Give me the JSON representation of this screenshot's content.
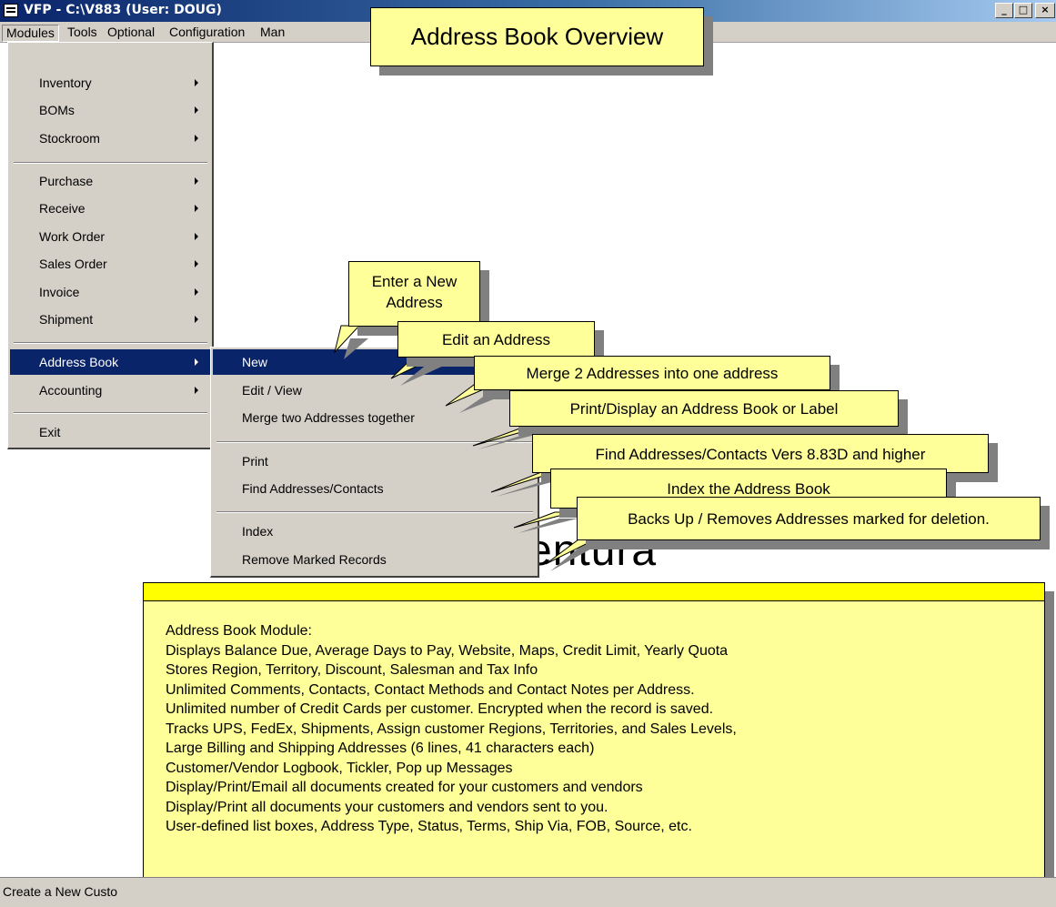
{
  "titlebar": {
    "title": "VFP - C:\\V883  (User: DOUG)",
    "minimize_label": "_",
    "maximize_label": "□",
    "close_label": "×"
  },
  "menubar": {
    "items": [
      "Modules",
      "Tools",
      "Optional",
      "Configuration",
      "Man"
    ]
  },
  "modules_menu": {
    "items": [
      {
        "label": "Inventory"
      },
      {
        "label": "BOMs"
      },
      {
        "label": "Stockroom"
      },
      {
        "label": "Purchase"
      },
      {
        "label": "Receive"
      },
      {
        "label": "Work Order"
      },
      {
        "label": "Sales Order"
      },
      {
        "label": "Invoice"
      },
      {
        "label": "Shipment"
      },
      {
        "label": "Address Book"
      },
      {
        "label": "Accounting"
      },
      {
        "label": "Exit"
      }
    ]
  },
  "address_submenu": {
    "items": [
      {
        "label": "New"
      },
      {
        "label": "Edit / View"
      },
      {
        "label": "Merge two Addresses together"
      },
      {
        "label": "Print"
      },
      {
        "label": "Find Addresses/Contacts"
      },
      {
        "label": "Index"
      },
      {
        "label": "Remove Marked Records"
      }
    ]
  },
  "callouts": {
    "overview": "Address Book Overview",
    "enter_new_line1": "Enter a New",
    "enter_new_line2": "Address",
    "edit": "Edit an Address",
    "merge": "Merge 2 Addresses into one address",
    "print": "Print/Display an Address Book or Label",
    "find": "Find Addresses/Contacts Vers 8.83D and higher",
    "index": "Index the Address Book",
    "backup": "Backs Up / Removes Addresses marked for deletion."
  },
  "background_text": "ventura",
  "info_panel": {
    "lines": [
      "Address Book Module:",
      "Displays Balance Due, Average Days to Pay, Website, Maps, Credit Limit, Yearly Quota",
      "Stores Region, Territory, Discount, Salesman and Tax Info",
      "Unlimited Comments, Contacts, Contact Methods and Contact Notes per Address.",
      "Unlimited number of Credit Cards per customer.  Encrypted when the record is saved.",
      "Tracks UPS, FedEx, Shipments, Assign customer Regions, Territories, and Sales Levels,",
      "Large Billing and Shipping Addresses (6 lines, 41 characters each)",
      "Customer/Vendor Logbook, Tickler, Pop up Messages",
      "Display/Print/Email all documents created for your customers and vendors",
      "Display/Print all documents your customers and vendors sent to you.",
      "User-defined list boxes, Address Type, Status, Terms, Ship Via, FOB, Source, etc."
    ]
  },
  "statusbar": {
    "text": "Create a New Custo"
  },
  "colors": {
    "title_active": "#0a246a",
    "menu_bg": "#d4d0c8",
    "highlight": "#0a246a",
    "callout_bg": "#ffff99",
    "panel_header": "#ffff00",
    "shadow": "#808080"
  }
}
